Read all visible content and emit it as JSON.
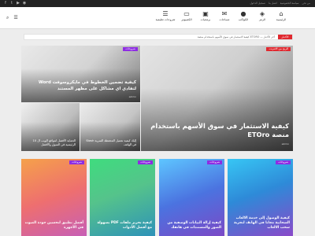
{
  "topbar": {
    "links": [
      "تسجيل الدخول",
      "اتصل بنا",
      "سياسة الخصوصية",
      "من نحن"
    ]
  },
  "nav": {
    "items": [
      {
        "label": "الرئيسية",
        "icon": "home-icon",
        "glyph": "⌂"
      },
      {
        "label": "الرمز",
        "icon": "tag-icon",
        "glyph": "◈"
      },
      {
        "label": "الكواكب",
        "icon": "planet-icon",
        "glyph": "●"
      },
      {
        "label": "مساجات",
        "icon": "chat-icon",
        "glyph": "✉"
      },
      {
        "label": "برمجيات",
        "icon": "code-icon",
        "glyph": "▣"
      },
      {
        "label": "الكمبيوتر",
        "icon": "computer-icon",
        "glyph": "▭"
      },
      {
        "label": "شروحات تعليمية",
        "icon": "book-icon",
        "glyph": "☰"
      }
    ]
  },
  "ticker": {
    "label": "الأخبار",
    "text": "كيفية الاستثمار في سوق الأسهم باستخدام منصة ETORO — آخر الأخبار"
  },
  "featured": {
    "big": {
      "category": "الربح من الانترنت",
      "title": "كيفية الاستثمار في سوق الأسهم باستخدام منصة ETOro",
      "meta": "admin"
    },
    "wide": {
      "category": "شروحات",
      "title": "كيفية تضمين الخطوط في مايكروسوفت Word لتفادي اي مشاكل على مظهر المستند",
      "meta": "admin"
    },
    "small1": {
      "title": "الحماية الأفضل لمواقع الويب ال 10 الرئيسية في السوق والأفضل"
    },
    "small2": {
      "title": "إليك كيفية تحميل المحفظة السرية Stash في الهاتف"
    }
  },
  "tiles": [
    {
      "category": "شروحات",
      "title": "كيفية الوصول إلى خدمة الالعاب السحابية مجانا في الهاتف لتجربة سحب الالعاب"
    },
    {
      "category": "شروحات",
      "title": "كيفية إزالة البيانات الوصفية من الصور والمستندات في هاتفك"
    },
    {
      "category": "شروحات",
      "title": "كيفية تحرير ملفات PDF بسهولة مع أفضل الأدوات"
    },
    {
      "category": "شروحات",
      "title": "أفضل تطبيق لتحسين جودة الصوت في الأجهزة"
    }
  ]
}
